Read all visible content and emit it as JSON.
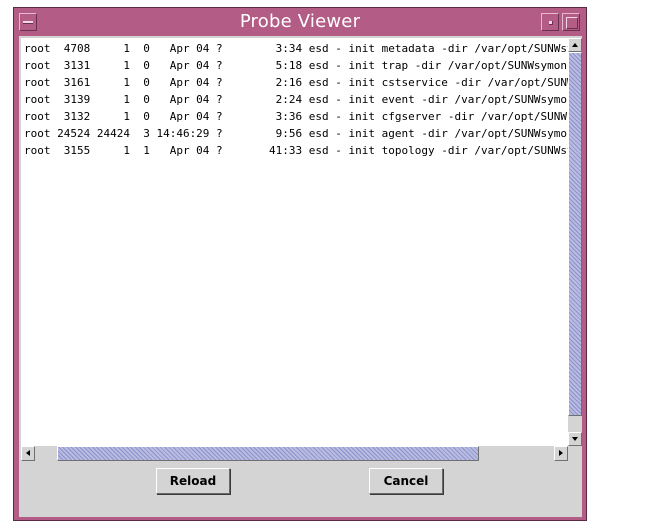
{
  "window": {
    "title": "Probe Viewer",
    "titlebar_color": "#b25c86"
  },
  "process_lines": [
    "root  4708     1  0   Apr 04 ?        3:34 esd - init metadata -dir /var/opt/SUNWsym",
    "root  3131     1  0   Apr 04 ?        5:18 esd - init trap -dir /var/opt/SUNWsymon -q",
    "root  3161     1  0   Apr 04 ?        2:16 esd - init cstservice -dir /var/opt/SUNWs",
    "root  3139     1  0   Apr 04 ?        2:24 esd - init event -dir /var/opt/SUNWsymon",
    "root  3132     1  0   Apr 04 ?        3:36 esd - init cfgserver -dir /var/opt/SUNWsy",
    "root 24524 24424  3 14:46:29 ?        9:56 esd - init agent -dir /var/opt/SUNWsymon",
    "root  3155     1  1   Apr 04 ?       41:33 esd - init topology -dir /var/opt/SUNWsym"
  ],
  "buttons": {
    "reload": "Reload",
    "cancel": "Cancel"
  },
  "icons": {
    "window_menu": "window-menu-icon",
    "minimize": "minimize-icon",
    "maximize": "maximize-icon"
  }
}
